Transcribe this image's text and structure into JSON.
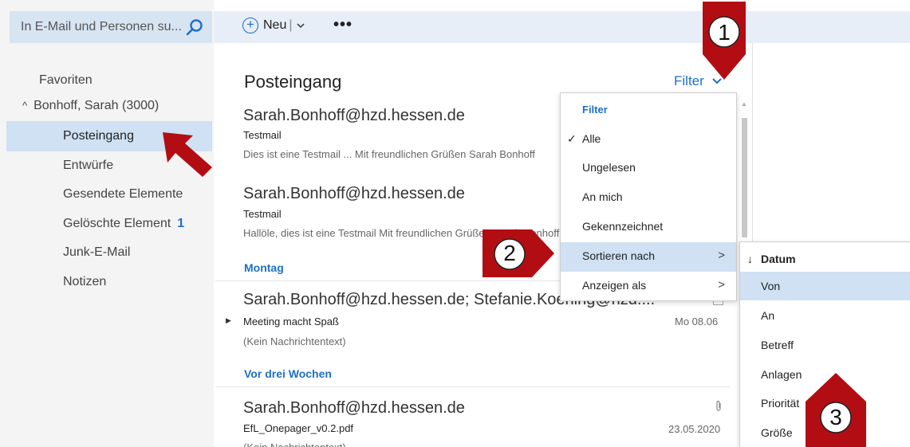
{
  "search": {
    "placeholder": "In E-Mail und Personen su..."
  },
  "toolbar": {
    "new_label": "Neu",
    "separator": "|",
    "more_label": "•••"
  },
  "sidebar": {
    "favorites": "Favoriten",
    "account": "Bonhoff, Sarah (3000)",
    "folders": [
      {
        "label": "Posteingang"
      },
      {
        "label": "Entwürfe"
      },
      {
        "label": "Gesendete Elemente"
      },
      {
        "label": "Gelöschte Element",
        "badge": "1"
      },
      {
        "label": "Junk-E-Mail"
      },
      {
        "label": "Notizen"
      }
    ]
  },
  "list": {
    "title": "Posteingang",
    "filter_label": "Filter",
    "messages": [
      {
        "from": "Sarah.Bonhoff@hzd.hessen.de",
        "subject": "Testmail",
        "preview": "Dies ist eine Testmail ... Mit freundlichen Grüßen Sarah Bonhoff"
      },
      {
        "from": "Sarah.Bonhoff@hzd.hessen.de",
        "subject": "Testmail",
        "preview": "Hallöle, dies ist eine Testmail Mit freundlichen Grüßen Sarah Bonhoff"
      },
      {
        "group": "Montag"
      },
      {
        "from": "Sarah.Bonhoff@hzd.hessen.de; Stefanie.Koening@hzd....",
        "subject": "Meeting macht Spaß",
        "preview": "(Kein Nachrichtentext)",
        "date": "Mo 08.06"
      },
      {
        "group": "Vor drei Wochen"
      },
      {
        "from": "Sarah.Bonhoff@hzd.hessen.de",
        "subject": "EfL_Onepager_v0.2.pdf",
        "preview": "(Kein Nachrichtentext)",
        "date": "23.05.2020"
      }
    ]
  },
  "filter_menu": {
    "header": "Filter",
    "items": [
      {
        "label": "Alle",
        "checked": true
      },
      {
        "label": "Ungelesen"
      },
      {
        "label": "An mich"
      },
      {
        "label": "Gekennzeichnet"
      },
      {
        "label": "Sortieren nach",
        "submenu": true
      },
      {
        "label": "Anzeigen als",
        "submenu": true
      }
    ]
  },
  "sort_menu": {
    "items": [
      {
        "label": "Datum",
        "selected": true
      },
      {
        "label": "Von"
      },
      {
        "label": "An"
      },
      {
        "label": "Betreff"
      },
      {
        "label": "Anlagen"
      },
      {
        "label": "Priorität"
      },
      {
        "label": "Größe"
      }
    ]
  },
  "callouts": [
    "1",
    "2",
    "3"
  ],
  "colors": {
    "accent": "#1f6fc5",
    "callout": "#b30d14",
    "selection": "#cfe1f3"
  }
}
